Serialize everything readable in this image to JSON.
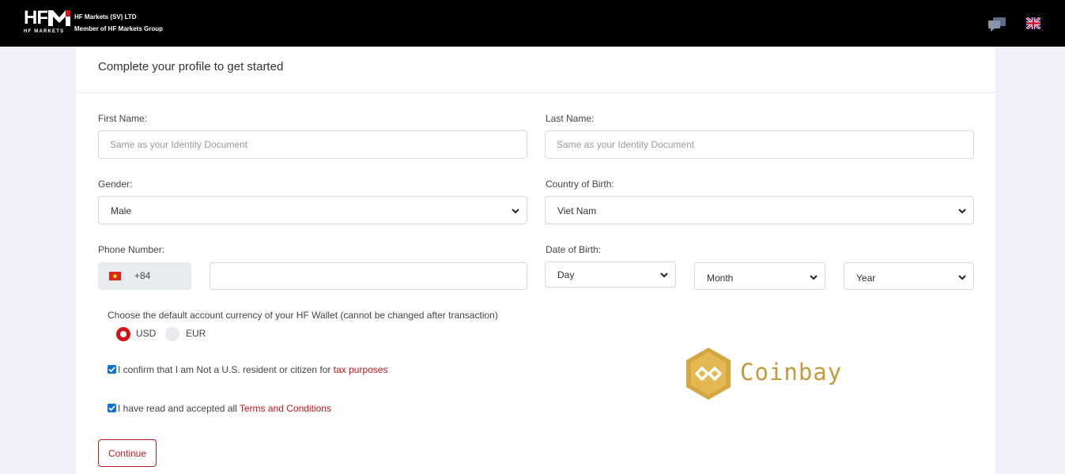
{
  "header": {
    "logo_main": "HFM",
    "logo_sub": "HF MARKETS",
    "company_line1": "HF Markets (SV) LTD",
    "company_line2": "Member of HF Markets Group"
  },
  "form": {
    "title": "Complete your profile to get started",
    "first_name": {
      "label": "First Name:",
      "placeholder": "Same as your Identity Document",
      "value": ""
    },
    "last_name": {
      "label": "Last Name:",
      "placeholder": "Same as your Identity Document",
      "value": ""
    },
    "gender": {
      "label": "Gender:",
      "value": "Male"
    },
    "country_of_birth": {
      "label": "Country of Birth:",
      "value": "Viet Nam"
    },
    "phone": {
      "label": "Phone Number:",
      "code": "+84",
      "value": ""
    },
    "date_of_birth": {
      "label": "Date of Birth:",
      "day": "Day",
      "month": "Month",
      "year": "Year"
    },
    "currency": {
      "prompt": "Choose the default account currency of your HF Wallet (cannot be changed after transaction)",
      "options": [
        "USD",
        "EUR"
      ],
      "selected": "USD"
    },
    "confirm_resident": {
      "text": "I confirm that I am Not a U.S. resident or citizen for ",
      "link": "tax purposes",
      "checked": true
    },
    "accept_terms": {
      "text": "I have read and accepted all ",
      "link": "Terms and Conditions",
      "checked": true
    },
    "continue_label": "Continue"
  },
  "watermark": {
    "text": "Coinbay"
  },
  "colors": {
    "accent": "#c21c24",
    "topbar": "#000000",
    "page_bg": "#f1f2f9",
    "checkbox": "#0b72d9",
    "coinbay_gold": "#c49a3b"
  }
}
